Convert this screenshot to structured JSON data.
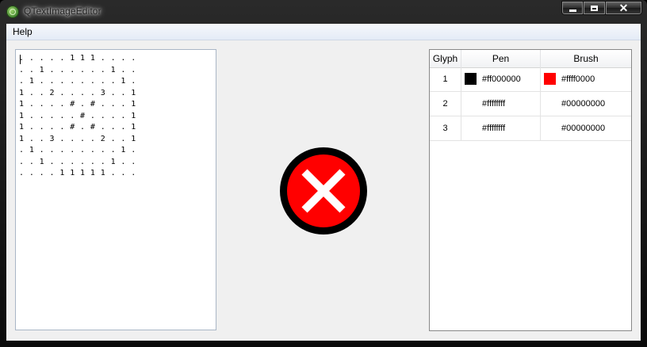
{
  "window": {
    "title": "QTextImageEditor"
  },
  "menubar": {
    "items": [
      "Help"
    ]
  },
  "editor": {
    "lines": [
      ". . . . . 1 1 1 . . . .",
      ". . 1 . . . . . . 1 . .",
      ". 1 . . . . . . . . 1 .",
      "1 . . 2 . . . . 3 . . 1",
      "1 . . . . # . # . . . 1",
      "1 . . . . . # . . . . 1",
      "1 . . . . # . # . . . 1",
      "1 . . 3 . . . . 2 . . 1",
      ". 1 . . . . . . . . 1 .",
      ". . 1 . . . . . . 1 . .",
      ". . . . 1 1 1 1 1 . . ."
    ]
  },
  "preview": {
    "icon": "error-x-icon",
    "colors": {
      "outer": "#000000",
      "fill": "#ff0000",
      "cross": "#ffffff"
    }
  },
  "table": {
    "headers": {
      "glyph": "Glyph",
      "pen": "Pen",
      "brush": "Brush"
    },
    "rows": [
      {
        "glyph": "1",
        "pen": "#ff000000",
        "pen_swatch": "#000000",
        "brush": "#ffff0000",
        "brush_swatch": "#ff0000"
      },
      {
        "glyph": "2",
        "pen": "#ffffffff",
        "pen_swatch": null,
        "brush": "#00000000",
        "brush_swatch": null
      },
      {
        "glyph": "3",
        "pen": "#ffffffff",
        "pen_swatch": null,
        "brush": "#00000000",
        "brush_swatch": null
      }
    ]
  }
}
